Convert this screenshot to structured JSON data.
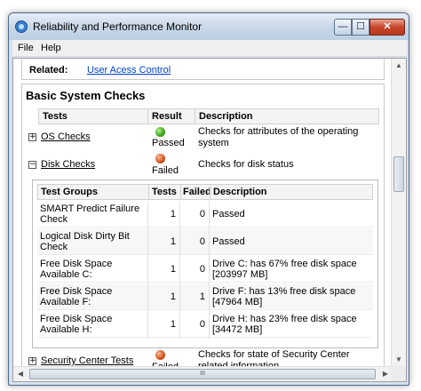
{
  "window": {
    "title": "Reliability and Performance Monitor",
    "minimize_glyph": "—",
    "maximize_glyph": "☐",
    "close_glyph": "✕"
  },
  "menu": [
    "File",
    "Help"
  ],
  "related": {
    "label": "Related:",
    "link": "User Acess Control"
  },
  "section": {
    "title": "Basic System Checks",
    "columns": [
      "Tests",
      "Result",
      "Description"
    ],
    "tests": [
      {
        "name": "OS Checks",
        "expander": "+",
        "result": "Passed",
        "status_color": "green",
        "description": "Checks for attributes of the operating system"
      },
      {
        "name": "Disk Checks",
        "expander": "−",
        "result": "Failed",
        "status_color": "red",
        "description": "Checks for disk status"
      },
      {
        "name": "Security Center Tests",
        "expander": "+",
        "result": "Failed",
        "status_color": "red",
        "description": "Checks for state of Security Center related information."
      }
    ]
  },
  "disk_groups": {
    "columns": [
      "Test Groups",
      "Tests",
      "Failed",
      "Description"
    ],
    "rows": [
      {
        "group": "SMART Predict Failure Check",
        "tests": "1",
        "failed": "0",
        "description": "Passed"
      },
      {
        "group": "Logical Disk Dirty Bit Check",
        "tests": "1",
        "failed": "0",
        "description": "Passed"
      },
      {
        "group": "Free Disk Space Available C:",
        "tests": "1",
        "failed": "0",
        "description": "Drive C: has 67% free disk space [203997 MB]"
      },
      {
        "group": "Free Disk Space Available F:",
        "tests": "1",
        "failed": "1",
        "description": "Drive F: has 13% free disk space [47964 MB]"
      },
      {
        "group": "Free Disk Space Available H:",
        "tests": "1",
        "failed": "0",
        "description": "Drive H: has 23% free disk space [34472 MB]"
      }
    ]
  },
  "scroll": {
    "up": "▲",
    "down": "▼",
    "left": "◀",
    "right": "▶",
    "grip": "III"
  }
}
